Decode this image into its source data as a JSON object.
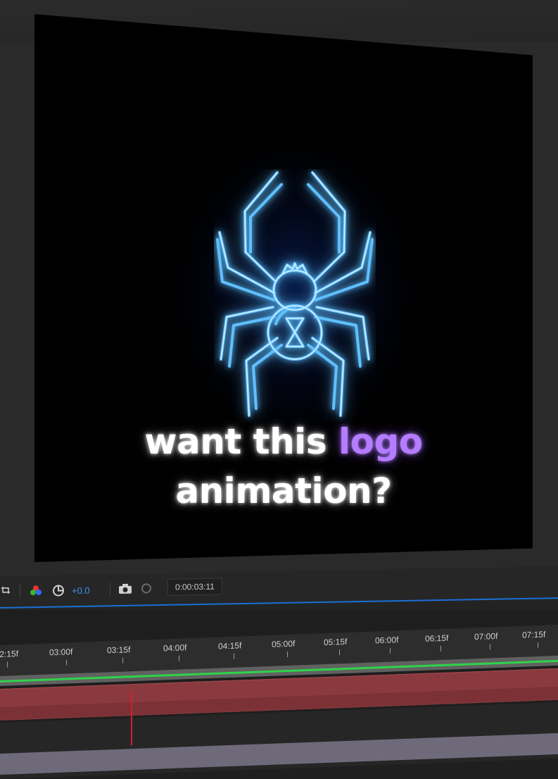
{
  "viewer": {
    "caption_line1_a": "want this",
    "caption_line1_b": "logo",
    "caption_line2": "animation?",
    "logo": "spider-neon-logo",
    "colors": {
      "neon_blue": "#3aa8ff",
      "accent_purple": "#b47cff",
      "background": "#000000"
    }
  },
  "toolbar": {
    "region_icon": "region-of-interest-icon",
    "channels_icon": "color-channels-icon",
    "exposure_icon": "exposure-reset-icon",
    "exposure_value": "+0.0",
    "snapshot_icon": "camera-icon",
    "show_snapshot_icon": "show-snapshot-icon",
    "current_time": "0:00:03:11"
  },
  "timeline": {
    "ticks": [
      ":2:15f",
      "03:00f",
      "03:15f",
      "04:00f",
      "04:15f",
      "05:00f",
      "05:15f",
      "06:00f",
      "06:15f",
      "07:00f",
      "07:15f"
    ],
    "colors": {
      "work_area": "#2fd34a",
      "layer": "#8a3a3f",
      "playhead": "#d0202a"
    }
  }
}
